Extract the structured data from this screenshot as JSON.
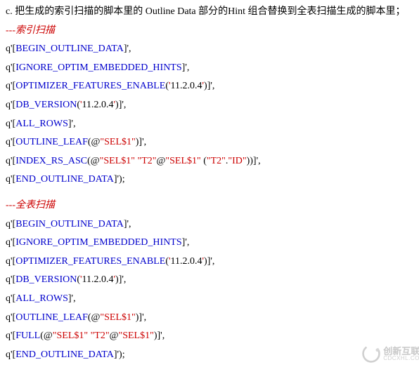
{
  "heading": "c. 把生成的索引扫描的脚本里的 Outline Data 部分的Hint 组合替换到全表扫描生成的脚本里；",
  "section1": {
    "comment": "---索引扫描",
    "lines": [
      [
        {
          "t": "q",
          "c": "q"
        },
        {
          "t": "q",
          "c": "'"
        },
        {
          "t": "bracket",
          "c": "["
        },
        {
          "t": "kw",
          "c": "BEGIN_OUTLINE_DATA"
        },
        {
          "t": "bracket",
          "c": "]"
        },
        {
          "t": "q",
          "c": "'"
        },
        {
          "t": "punct",
          "c": ","
        }
      ],
      [
        {
          "t": "q",
          "c": "q"
        },
        {
          "t": "q",
          "c": "'"
        },
        {
          "t": "bracket",
          "c": "["
        },
        {
          "t": "kw",
          "c": "IGNORE_OPTIM_EMBEDDED_HINTS"
        },
        {
          "t": "bracket",
          "c": "]"
        },
        {
          "t": "q",
          "c": "'"
        },
        {
          "t": "punct",
          "c": ","
        }
      ],
      [
        {
          "t": "q",
          "c": "q"
        },
        {
          "t": "q",
          "c": "'"
        },
        {
          "t": "bracket",
          "c": "["
        },
        {
          "t": "kw",
          "c": "OPTIMIZER_FEATURES_ENABLE"
        },
        {
          "t": "punct",
          "c": "("
        },
        {
          "t": "str",
          "c": "'11.2.0.4'"
        },
        {
          "t": "punct",
          "c": ")"
        },
        {
          "t": "bracket",
          "c": "]"
        },
        {
          "t": "q",
          "c": "'"
        },
        {
          "t": "punct",
          "c": ","
        }
      ],
      [
        {
          "t": "q",
          "c": "q"
        },
        {
          "t": "q",
          "c": "'"
        },
        {
          "t": "bracket",
          "c": "["
        },
        {
          "t": "kw",
          "c": "DB_VERSION"
        },
        {
          "t": "punct",
          "c": "("
        },
        {
          "t": "str",
          "c": "'11.2.0.4'"
        },
        {
          "t": "punct",
          "c": ")"
        },
        {
          "t": "bracket",
          "c": "]"
        },
        {
          "t": "q",
          "c": "'"
        },
        {
          "t": "punct",
          "c": ","
        }
      ],
      [
        {
          "t": "q",
          "c": "q"
        },
        {
          "t": "q",
          "c": "'"
        },
        {
          "t": "bracket",
          "c": "["
        },
        {
          "t": "kw",
          "c": "ALL_ROWS"
        },
        {
          "t": "bracket",
          "c": "]"
        },
        {
          "t": "q",
          "c": "'"
        },
        {
          "t": "punct",
          "c": ","
        }
      ],
      [
        {
          "t": "q",
          "c": "q"
        },
        {
          "t": "q",
          "c": "'"
        },
        {
          "t": "bracket",
          "c": "["
        },
        {
          "t": "kw",
          "c": "OUTLINE_LEAF"
        },
        {
          "t": "punct",
          "c": "(@"
        },
        {
          "t": "str",
          "c": "\"SEL$1\""
        },
        {
          "t": "punct",
          "c": ")"
        },
        {
          "t": "bracket",
          "c": "]"
        },
        {
          "t": "q",
          "c": "'"
        },
        {
          "t": "punct",
          "c": ","
        }
      ],
      [
        {
          "t": "q",
          "c": "q"
        },
        {
          "t": "q",
          "c": "'"
        },
        {
          "t": "bracket",
          "c": "["
        },
        {
          "t": "kw",
          "c": "INDEX_RS_ASC"
        },
        {
          "t": "punct",
          "c": "(@"
        },
        {
          "t": "str",
          "c": "\"SEL$1\""
        },
        {
          "t": "punct",
          "c": " "
        },
        {
          "t": "str",
          "c": "\"T2\""
        },
        {
          "t": "punct",
          "c": "@"
        },
        {
          "t": "str",
          "c": "\"SEL$1\""
        },
        {
          "t": "punct",
          "c": " ("
        },
        {
          "t": "str",
          "c": "\"T2\""
        },
        {
          "t": "punct",
          "c": "."
        },
        {
          "t": "str",
          "c": "\"ID\""
        },
        {
          "t": "punct",
          "c": "))"
        },
        {
          "t": "bracket",
          "c": "]"
        },
        {
          "t": "q",
          "c": "'"
        },
        {
          "t": "punct",
          "c": ","
        }
      ],
      [
        {
          "t": "q",
          "c": "q"
        },
        {
          "t": "q",
          "c": "'"
        },
        {
          "t": "bracket",
          "c": "["
        },
        {
          "t": "kw",
          "c": "END_OUTLINE_DATA"
        },
        {
          "t": "bracket",
          "c": "]"
        },
        {
          "t": "q",
          "c": "'"
        },
        {
          "t": "punct",
          "c": ");"
        }
      ]
    ]
  },
  "section2": {
    "comment": "---全表扫描",
    "lines": [
      [
        {
          "t": "q",
          "c": "q"
        },
        {
          "t": "q",
          "c": "'"
        },
        {
          "t": "bracket",
          "c": "["
        },
        {
          "t": "kw",
          "c": "BEGIN_OUTLINE_DATA"
        },
        {
          "t": "bracket",
          "c": "]"
        },
        {
          "t": "q",
          "c": "'"
        },
        {
          "t": "punct",
          "c": ","
        }
      ],
      [
        {
          "t": "q",
          "c": "q"
        },
        {
          "t": "q",
          "c": "'"
        },
        {
          "t": "bracket",
          "c": "["
        },
        {
          "t": "kw",
          "c": "IGNORE_OPTIM_EMBEDDED_HINTS"
        },
        {
          "t": "bracket",
          "c": "]"
        },
        {
          "t": "q",
          "c": "'"
        },
        {
          "t": "punct",
          "c": ","
        }
      ],
      [
        {
          "t": "q",
          "c": "q"
        },
        {
          "t": "q",
          "c": "'"
        },
        {
          "t": "bracket",
          "c": "["
        },
        {
          "t": "kw",
          "c": "OPTIMIZER_FEATURES_ENABLE"
        },
        {
          "t": "punct",
          "c": "("
        },
        {
          "t": "str",
          "c": "'11.2.0.4'"
        },
        {
          "t": "punct",
          "c": ")"
        },
        {
          "t": "bracket",
          "c": "]"
        },
        {
          "t": "q",
          "c": "'"
        },
        {
          "t": "punct",
          "c": ","
        }
      ],
      [
        {
          "t": "q",
          "c": "q"
        },
        {
          "t": "q",
          "c": "'"
        },
        {
          "t": "bracket",
          "c": "["
        },
        {
          "t": "kw",
          "c": "DB_VERSION"
        },
        {
          "t": "punct",
          "c": "("
        },
        {
          "t": "str",
          "c": "'11.2.0.4'"
        },
        {
          "t": "punct",
          "c": ")"
        },
        {
          "t": "bracket",
          "c": "]"
        },
        {
          "t": "q",
          "c": "'"
        },
        {
          "t": "punct",
          "c": ","
        }
      ],
      [
        {
          "t": "q",
          "c": "q"
        },
        {
          "t": "q",
          "c": "'"
        },
        {
          "t": "bracket",
          "c": "["
        },
        {
          "t": "kw",
          "c": "ALL_ROWS"
        },
        {
          "t": "bracket",
          "c": "]"
        },
        {
          "t": "q",
          "c": "'"
        },
        {
          "t": "punct",
          "c": ","
        }
      ],
      [
        {
          "t": "q",
          "c": "q"
        },
        {
          "t": "q",
          "c": "'"
        },
        {
          "t": "bracket",
          "c": "["
        },
        {
          "t": "kw",
          "c": "OUTLINE_LEAF"
        },
        {
          "t": "punct",
          "c": "(@"
        },
        {
          "t": "str",
          "c": "\"SEL$1\""
        },
        {
          "t": "punct",
          "c": ")"
        },
        {
          "t": "bracket",
          "c": "]"
        },
        {
          "t": "q",
          "c": "'"
        },
        {
          "t": "punct",
          "c": ","
        }
      ],
      [
        {
          "t": "q",
          "c": "q"
        },
        {
          "t": "q",
          "c": "'"
        },
        {
          "t": "bracket",
          "c": "["
        },
        {
          "t": "kw",
          "c": "FULL"
        },
        {
          "t": "punct",
          "c": "(@"
        },
        {
          "t": "str",
          "c": "\"SEL$1\""
        },
        {
          "t": "punct",
          "c": " "
        },
        {
          "t": "str",
          "c": "\"T2\""
        },
        {
          "t": "punct",
          "c": "@"
        },
        {
          "t": "str",
          "c": "\"SEL$1\""
        },
        {
          "t": "punct",
          "c": ")"
        },
        {
          "t": "bracket",
          "c": "]"
        },
        {
          "t": "q",
          "c": "'"
        },
        {
          "t": "punct",
          "c": ","
        }
      ],
      [
        {
          "t": "q",
          "c": "q"
        },
        {
          "t": "q",
          "c": "'"
        },
        {
          "t": "bracket",
          "c": "["
        },
        {
          "t": "kw",
          "c": "END_OUTLINE_DATA"
        },
        {
          "t": "bracket",
          "c": "]"
        },
        {
          "t": "q",
          "c": "'"
        },
        {
          "t": "punct",
          "c": ");"
        }
      ]
    ]
  },
  "logo": {
    "cn": "创新互联",
    "en": "CDCXHL.COM"
  }
}
